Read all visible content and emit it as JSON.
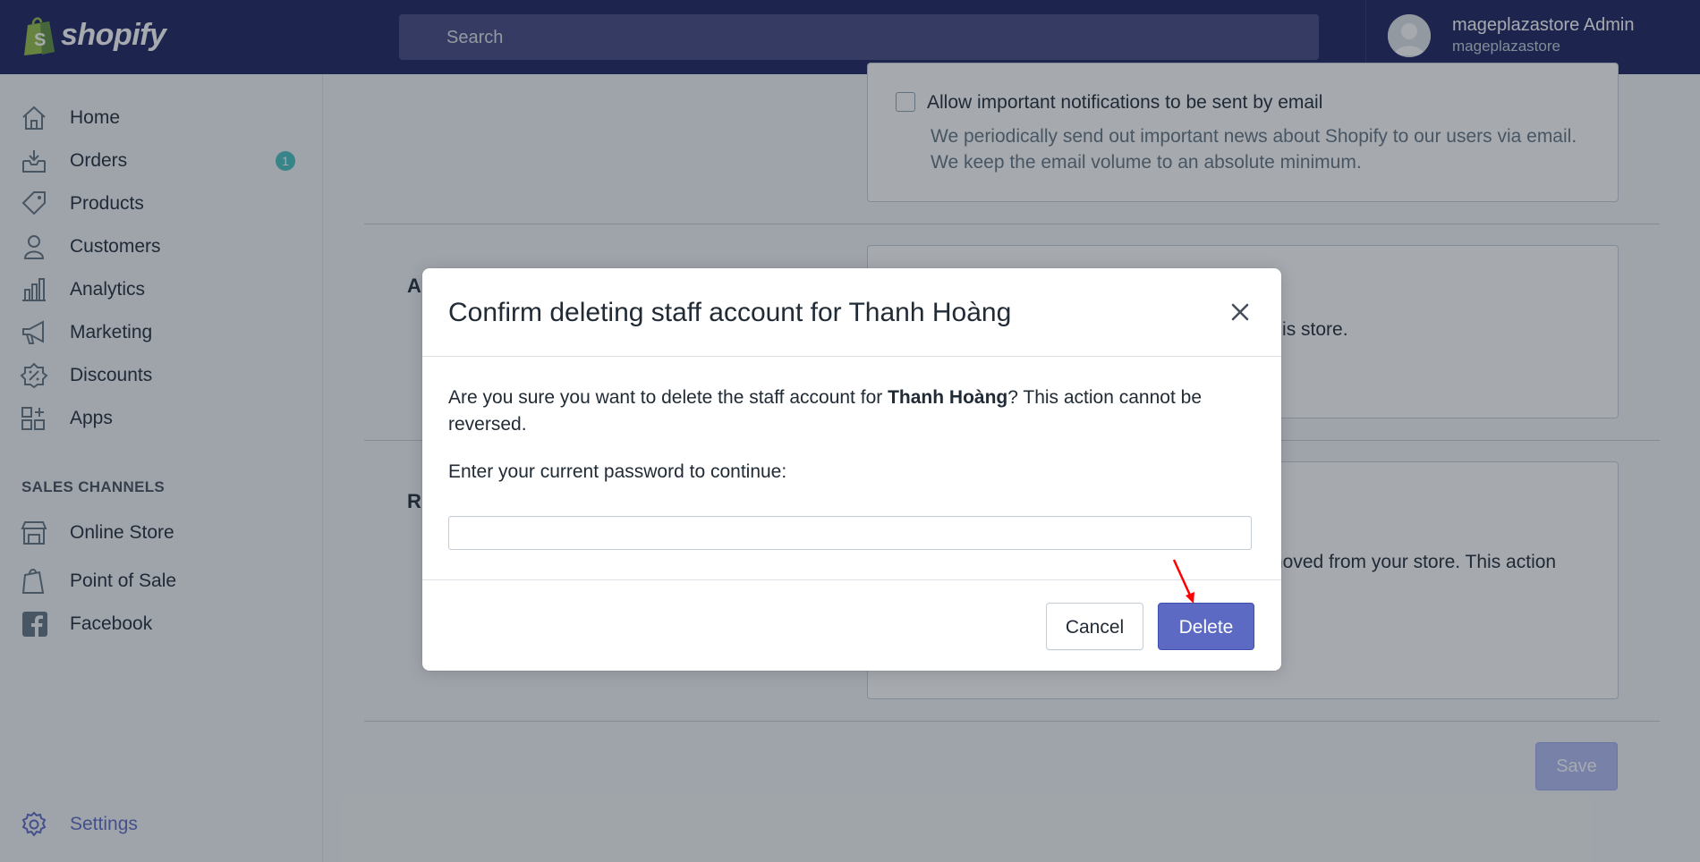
{
  "topbar": {
    "logo_text": "shopify",
    "search_placeholder": "Search",
    "user_name": "mageplazastore Admin",
    "user_store": "mageplazastore"
  },
  "sidebar": {
    "items": [
      {
        "label": "Home",
        "icon": "home-icon"
      },
      {
        "label": "Orders",
        "icon": "orders-icon",
        "badge": "1"
      },
      {
        "label": "Products",
        "icon": "tag-icon"
      },
      {
        "label": "Customers",
        "icon": "customer-icon"
      },
      {
        "label": "Analytics",
        "icon": "bar-chart-icon"
      },
      {
        "label": "Marketing",
        "icon": "megaphone-icon"
      },
      {
        "label": "Discounts",
        "icon": "discount-icon"
      },
      {
        "label": "Apps",
        "icon": "apps-icon"
      }
    ],
    "sales_channels_heading": "SALES CHANNELS",
    "channels": [
      {
        "label": "Online Store",
        "icon": "store-icon"
      },
      {
        "label": "Point of Sale",
        "icon": "pos-icon"
      },
      {
        "label": "Facebook",
        "icon": "facebook-icon"
      }
    ],
    "settings_label": "Settings"
  },
  "background": {
    "notify_label": "Allow important notifications to be sent by email",
    "notify_desc_1": "We periodically send out important news about Shopify to our users via email.",
    "notify_desc_2": "We keep the email volume to an absolute minimum.",
    "section2_heading_partial": "A",
    "section2_text_partial": "ts of this store.",
    "section3_heading_partial": "R",
    "section3_text_partial": "noved from your store. This action",
    "save_label": "Save"
  },
  "modal": {
    "title": "Confirm deleting staff account for Thanh Hoàng",
    "body_prefix": "Are you sure you want to delete the staff account for ",
    "body_name": "Thanh Hoàng",
    "body_suffix": "? This action cannot be reversed.",
    "password_label": "Enter your current password to continue:",
    "password_value": "",
    "cancel_label": "Cancel",
    "delete_label": "Delete"
  },
  "colors": {
    "topbar": "#1c2260",
    "primary": "#5c6ac4",
    "badge": "#47c1bf",
    "annotation_arrow": "#ff0000"
  }
}
